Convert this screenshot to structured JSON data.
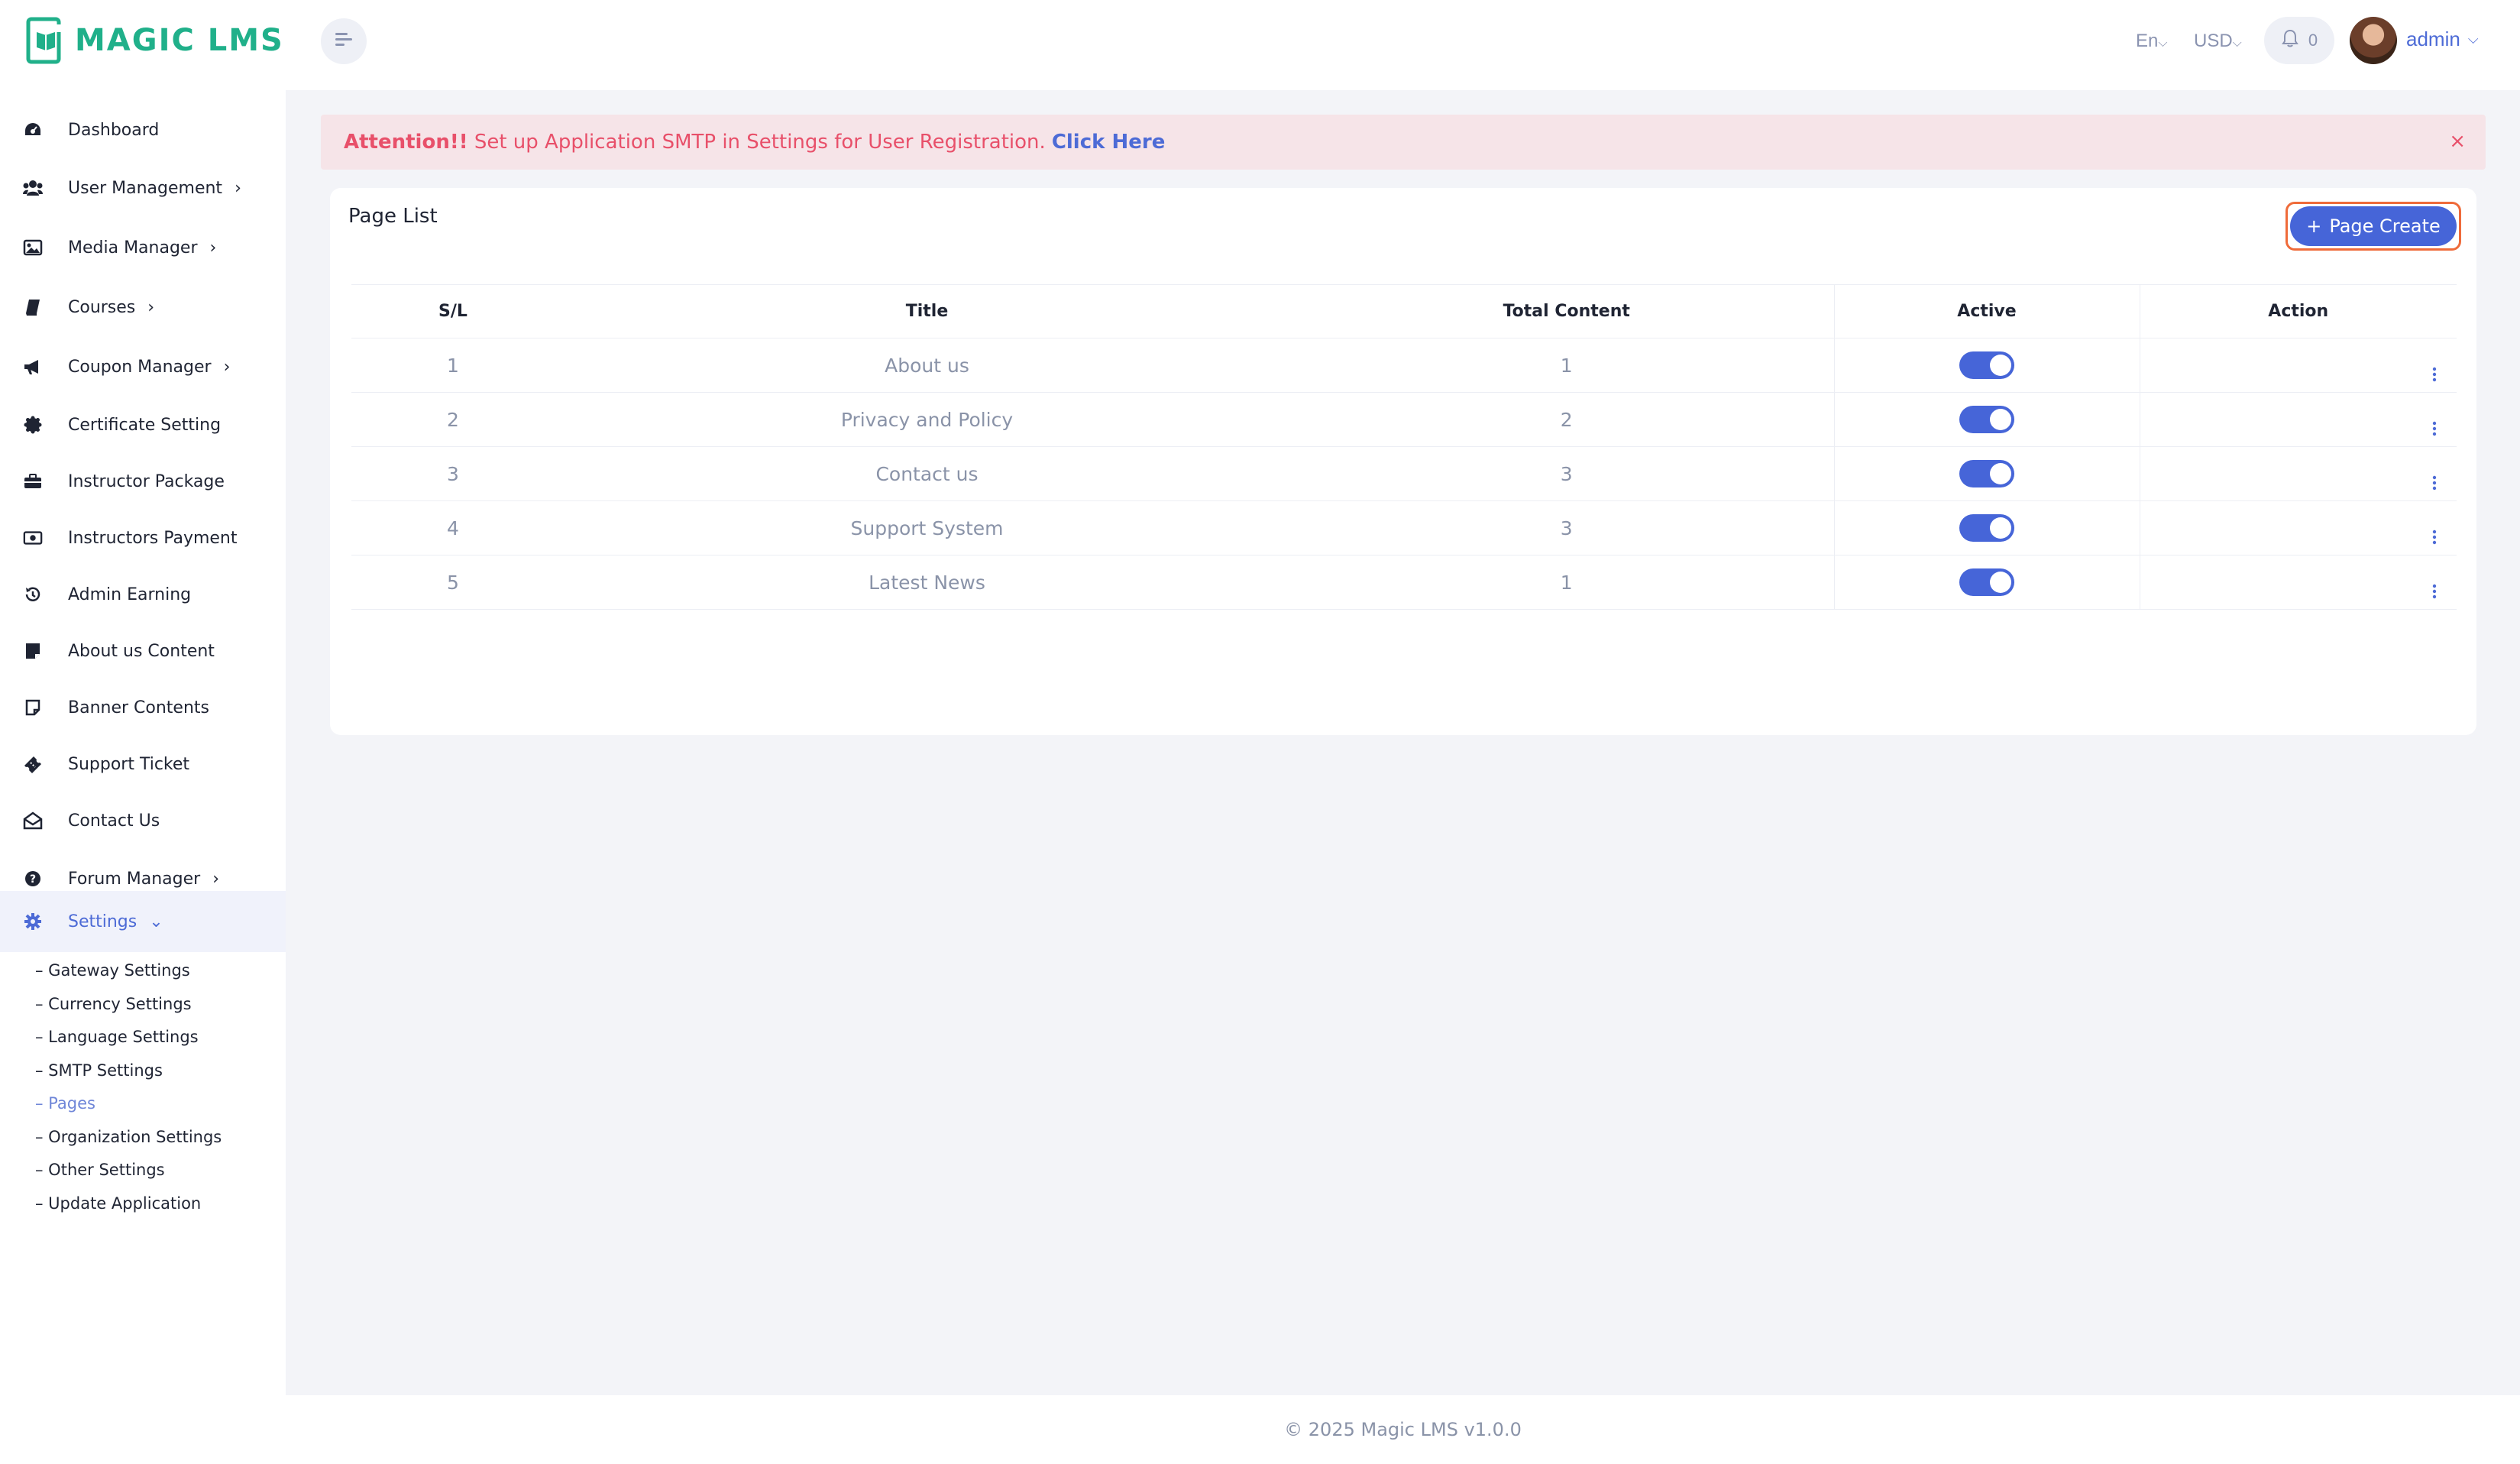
{
  "header": {
    "logo_text": "MAGIC LMS",
    "language": "En",
    "currency": "USD",
    "notification_count": "0",
    "user_name": "admin"
  },
  "sidebar": {
    "items": [
      {
        "label": "Dashboard",
        "icon": "dashboard-icon"
      },
      {
        "label": "User Management",
        "icon": "users-icon",
        "chevron": "›"
      },
      {
        "label": "Media Manager",
        "icon": "image-icon",
        "chevron": "›"
      },
      {
        "label": "Courses",
        "icon": "book-icon",
        "chevron": "›"
      },
      {
        "label": "Coupon Manager",
        "icon": "megaphone-icon",
        "chevron": "›"
      },
      {
        "label": "Certificate Setting",
        "icon": "certificate-icon"
      },
      {
        "label": "Instructor Package",
        "icon": "briefcase-icon"
      },
      {
        "label": "Instructors Payment",
        "icon": "money-icon"
      },
      {
        "label": "Admin Earning",
        "icon": "history-icon"
      },
      {
        "label": "About us Content",
        "icon": "note-icon"
      },
      {
        "label": "Banner Contents",
        "icon": "sticky-note-icon"
      },
      {
        "label": "Support Ticket",
        "icon": "ticket-icon"
      },
      {
        "label": "Contact Us",
        "icon": "envelope-icon"
      },
      {
        "label": "Forum Manager",
        "icon": "question-icon",
        "chevron": "›"
      },
      {
        "label": "Settings",
        "icon": "gear-icon",
        "chevron": "⌄"
      }
    ],
    "settings_sub": [
      "– Gateway Settings",
      "– Currency Settings",
      "– Language Settings",
      "– SMTP Settings",
      "– Pages",
      "– Organization Settings",
      "– Other Settings",
      "– Update Application"
    ]
  },
  "alert": {
    "prefix": "Attention!!",
    "message": "Set up Application SMTP in Settings for User Registration.",
    "link": "Click Here",
    "close": "×"
  },
  "card": {
    "title": "Page List",
    "create_label": "Page Create",
    "columns": [
      "S/L",
      "Title",
      "Total Content",
      "Active",
      "Action"
    ],
    "rows": [
      {
        "sl": "1",
        "title": "About us",
        "total": "1",
        "active": true
      },
      {
        "sl": "2",
        "title": "Privacy and Policy",
        "total": "2",
        "active": true
      },
      {
        "sl": "3",
        "title": "Contact us",
        "total": "3",
        "active": true
      },
      {
        "sl": "4",
        "title": "Support System",
        "total": "3",
        "active": true
      },
      {
        "sl": "5",
        "title": "Latest News",
        "total": "1",
        "active": true
      }
    ]
  },
  "footer": {
    "text": "© 2025 Magic LMS v1.0.0"
  },
  "colors": {
    "brand_green": "#20b08a",
    "accent_blue": "#4665d8",
    "alert_red": "#e8506a",
    "alert_bg": "#f6e4e8",
    "highlight_orange": "#ef6b3a"
  }
}
